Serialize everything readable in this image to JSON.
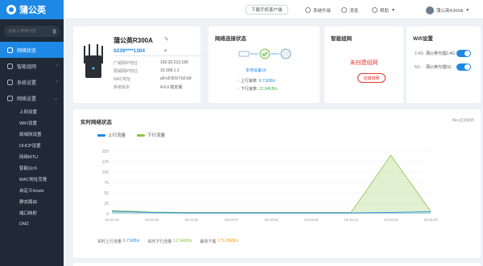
{
  "app": {
    "brand": "蒲公英"
  },
  "sidebar": {
    "search_placeholder": "请输入搜索内容",
    "items": [
      {
        "label": "网络状态",
        "active": true
      },
      {
        "label": "智能组网"
      },
      {
        "label": "系统设置"
      },
      {
        "label": "网络设置"
      }
    ],
    "sub_items": [
      "上网设置",
      "WiFi设置",
      "局域网设置",
      "DHCP设置",
      "网络MTU",
      "智能QoS",
      "MAC地址克隆",
      "自定义Hosts",
      "静态路由",
      "端口映射",
      "DMZ"
    ]
  },
  "topbar": {
    "download": "下载手机客户端",
    "upgrade": "系统升级",
    "news": "消息",
    "help": "帮助",
    "device": "蒲公英R300A"
  },
  "device": {
    "name": "蒲公英R300A",
    "sn": "0239****1304",
    "fields": [
      {
        "label": "广域网IP地址:",
        "value": "192.32.213.190"
      },
      {
        "label": "局域网IP地址:",
        "value": "10.168.1.1"
      },
      {
        "label": "MAC地址:",
        "value": "a0:c5:f2:b7:b2:b9"
      },
      {
        "label": "系统版本:",
        "value": "4.6.0 稳定版"
      }
    ]
  },
  "network": {
    "title": "网络连接状态",
    "device_count": "本地设备10",
    "up_label": "上行速率:",
    "up_value": "6.71KB/s",
    "down_label": "下行速率:",
    "down_value": "12.34KB/s"
  },
  "smart": {
    "title": "智能组网",
    "status": "未创建组网",
    "button": "创建组网"
  },
  "wifi": {
    "title": "Wifi设置",
    "bands": [
      {
        "band": "2.4G:",
        "ssid": "蒲公英代理2.4G",
        "on": true
      },
      {
        "band": "5G:",
        "ssid": "蒲公英代理5G",
        "on": true
      }
    ]
  },
  "chart": {
    "title": "实时网络状态",
    "corner": "每5s自动刷新",
    "foot": [
      {
        "label": "实时上行流量",
        "value": "6.71KB/s",
        "color": "#1e88e5"
      },
      {
        "label": "实时下行流量",
        "value": "12.34KB/s",
        "color": "#8bc34a"
      },
      {
        "label": "最快下载",
        "value": "171.05KB/s",
        "color": "#ff9800"
      }
    ]
  },
  "chart_data": {
    "type": "area",
    "x": [
      "19:42:15",
      "19:42:20",
      "19:42:51",
      "19:42:57",
      "19:43:02",
      "19:43:08",
      "19:43:13",
      "19:43:19",
      "19:43:25"
    ],
    "ylim": [
      0,
      150
    ],
    "yticks": [
      0,
      25,
      50,
      75,
      100,
      125,
      150
    ],
    "series": [
      {
        "name": "上行流量",
        "color": "#1e88e5",
        "values": [
          6,
          3,
          2,
          2,
          2,
          2,
          2,
          3,
          5
        ]
      },
      {
        "name": "下行流量",
        "color": "#8bc34a",
        "values": [
          8,
          4,
          3,
          3,
          3,
          3,
          3,
          140,
          6
        ]
      }
    ]
  }
}
